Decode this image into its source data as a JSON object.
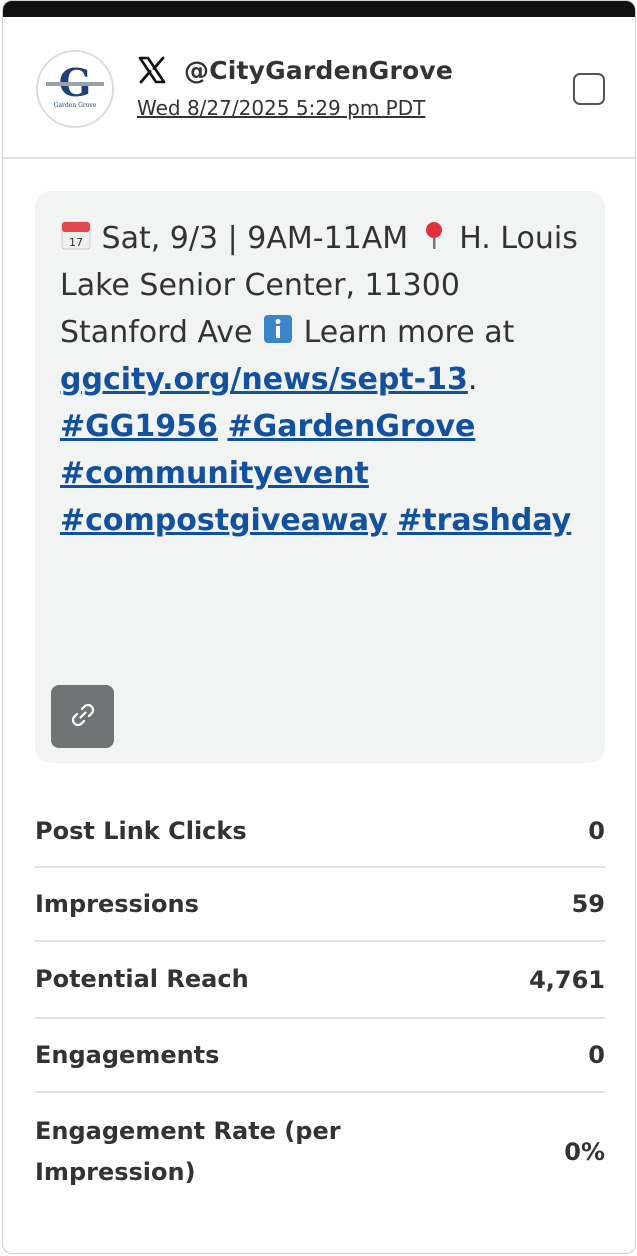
{
  "post": {
    "network_icon": "x-logo-icon",
    "handle": "@CityGardenGrove",
    "timestamp": "Wed 8/27/2025 5:29 pm PDT",
    "avatar_initials": "G",
    "avatar_caption": "Garden Grove",
    "text_date": "Sat, 9/3 | 9AM-11AM",
    "text_location": "H. Louis Lake Senior Center, 11300 Stanford Ave",
    "text_learn": "Learn more at",
    "link": "ggcity.org/news/sept-13",
    "period": ".",
    "hashtags": [
      "#GG1956",
      "#GardenGrove",
      "#communityevent",
      "#compostgiveaway",
      "#trashday"
    ],
    "link_button_icon": "link-icon"
  },
  "metrics": [
    {
      "label": "Post Link Clicks",
      "value": "0"
    },
    {
      "label": "Impressions",
      "value": "59"
    },
    {
      "label": "Potential Reach",
      "value": "4,761"
    },
    {
      "label": "Engagements",
      "value": "0"
    },
    {
      "label": "Engagement Rate (per Impression)",
      "value": "0%"
    }
  ],
  "colors": {
    "hashtag": "#1250a0",
    "post_bg": "#f2f3f3",
    "topbar": "#111111"
  }
}
